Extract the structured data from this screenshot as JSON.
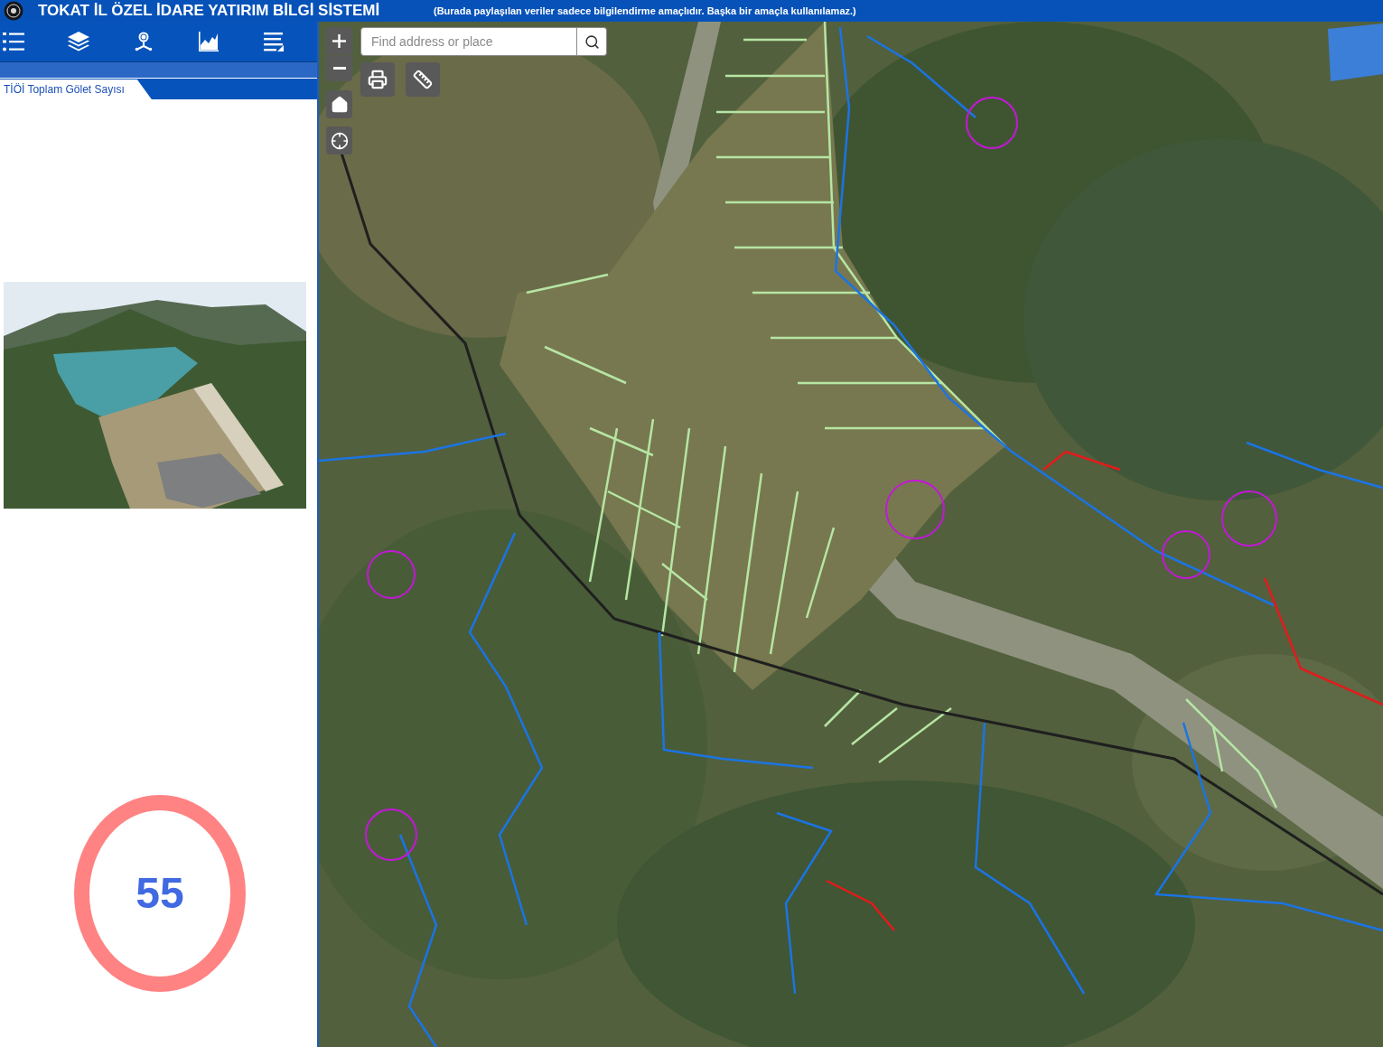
{
  "header": {
    "title": "TOKAT İL ÖZEL İDARE YATIRIM BİLGİ SİSTEMİ",
    "notice": "(Burada paylaşılan veriler sadece bilgilendirme amaçlıdır. Başka bir amaçla kullanılamaz.)"
  },
  "panel": {
    "tabs": [
      {
        "label": "TİÖİ Toplam Gölet Sayısı",
        "selected": true
      }
    ],
    "count": "55"
  },
  "map": {
    "search": {
      "placeholder": "Find address or place"
    }
  }
}
